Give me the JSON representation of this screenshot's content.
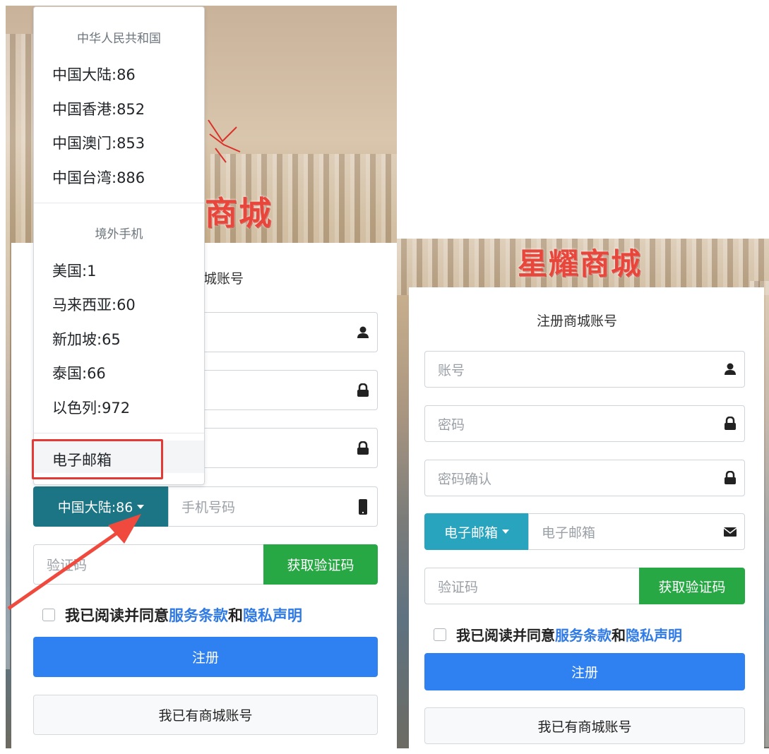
{
  "brand": {
    "logo_left": "商城",
    "logo_right": "星耀商城"
  },
  "left_form": {
    "title_fragment": "城账号",
    "country_button": "中国大陆:86",
    "phone_placeholder": "手机号码",
    "captcha_placeholder": "验证码",
    "get_code": "获取验证码",
    "agree_prefix": "我已阅读并同意",
    "terms": "服务条款",
    "and": "和",
    "privacy": "隐私声明",
    "register": "注册",
    "have_account": "我已有商城账号"
  },
  "dropdown": {
    "header_cn": "中华人民共和国",
    "items_cn": [
      "中国大陆:86",
      "中国香港:852",
      "中国澳门:853",
      "中国台湾:886"
    ],
    "header_abroad": "境外手机",
    "items_abroad": [
      "美国:1",
      "马来西亚:60",
      "新加坡:65",
      "泰国:66",
      "以色列:972"
    ],
    "email": "电子邮箱"
  },
  "right_form": {
    "title": "注册商城账号",
    "account_placeholder": "账号",
    "password_placeholder": "密码",
    "confirm_placeholder": "密码确认",
    "email_button": "电子邮箱",
    "email_placeholder": "电子邮箱",
    "captcha_placeholder": "验证码",
    "get_code": "获取验证码",
    "agree_prefix": "我已阅读并同意",
    "terms": "服务条款",
    "and": "和",
    "privacy": "隐私声明",
    "register": "注册",
    "have_account": "我已有商城账号"
  },
  "colors": {
    "primary": "#2f80f0",
    "success": "#28a745",
    "teal_dark": "#1c7584",
    "teal": "#29a4be",
    "link": "#2f7ae5",
    "highlight": "#e53935"
  }
}
